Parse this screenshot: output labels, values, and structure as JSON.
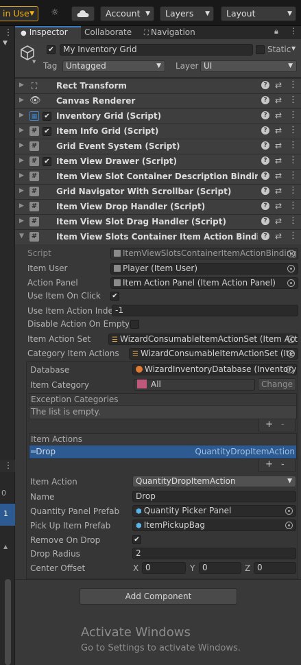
{
  "toolbar": {
    "in_use": "in Use",
    "account": "Account",
    "layers": "Layers",
    "layout": "Layout"
  },
  "tabs": [
    "Inspector",
    "Collaborate",
    "Navigation"
  ],
  "header": {
    "object_name": "My Inventory Grid",
    "static_label": "Static",
    "tag_label": "Tag",
    "tag_value": "Untagged",
    "layer_label": "Layer",
    "layer_value": "UI"
  },
  "components": [
    {
      "name": "Rect Transform",
      "icon": "rect-transform-icon",
      "checkbox": false
    },
    {
      "name": "Canvas Renderer",
      "icon": "eye-icon",
      "checkbox": false
    },
    {
      "name": "Inventory Grid (Script)",
      "icon": "grid-icon",
      "checkbox": true
    },
    {
      "name": "Item Info Grid (Script)",
      "icon": "script-icon",
      "checkbox": true
    },
    {
      "name": "Grid Event System (Script)",
      "icon": "script-icon",
      "checkbox": false
    },
    {
      "name": "Item View Drawer (Script)",
      "icon": "script-icon",
      "checkbox": true
    },
    {
      "name": "Item View Slot Container Description Binding (Scri",
      "icon": "script-icon",
      "checkbox": false
    },
    {
      "name": "Grid Navigator With Scrollbar (Script)",
      "icon": "script-icon",
      "checkbox": false
    },
    {
      "name": "Item View Drop Handler (Script)",
      "icon": "script-icon",
      "checkbox": false
    },
    {
      "name": "Item View Slot Drag Handler (Script)",
      "icon": "script-icon",
      "checkbox": false
    },
    {
      "name": "Item View Slots Container Item Action Binding (Sc",
      "icon": "script-icon",
      "checkbox": false
    }
  ],
  "props": {
    "script_label": "Script",
    "script_value": "ItemViewSlotsContainerItemActionBinding",
    "item_user_label": "Item User",
    "item_user_value": "Player (Item User)",
    "action_panel_label": "Action Panel",
    "action_panel_value": "Item Action Panel (Item Action Panel)",
    "use_item_label": "Use Item On Click",
    "use_item_checked": true,
    "use_index_label": "Use Item Action Index",
    "use_index_value": "-1",
    "disable_label": "Disable Action On Empty S",
    "disable_checked": false,
    "action_set_label": "Item Action Set",
    "action_set_value": "WizardConsumableItemActionSet (Item Act",
    "category_label": "Category Item Actions",
    "category_value": "WizardConsumableItemActionSet (Ite"
  },
  "sub": {
    "database_label": "Database",
    "database_value": "WizardInventoryDatabase (Inventory",
    "item_category_label": "Item Category",
    "item_category_value": "All",
    "change_button": "Change",
    "exception_header": "Exception Categories",
    "exception_empty": "The list is empty.",
    "plus": "+",
    "minus": "-",
    "item_actions_header": "Item Actions",
    "row_left": "Drop",
    "row_right": "QuantityDropItemAction",
    "item_action_label": "Item Action",
    "item_action_value": "QuantityDropItemAction",
    "name_label": "Name",
    "name_value": "Drop",
    "quantity_label": "Quantity Panel Prefab",
    "quantity_value": "Quantity Picker Panel",
    "pickup_label": "Pick Up Item Prefab",
    "pickup_value": "ItemPickupBag",
    "remove_label": "Remove On Drop",
    "remove_checked": true,
    "radius_label": "Drop Radius",
    "radius_value": "2",
    "offset_label": "Center Offset",
    "x_label": "X",
    "x_value": "0",
    "y_label": "Y",
    "y_value": "0",
    "z_label": "Z",
    "z_value": "0"
  },
  "footer": {
    "add_component": "Add Component",
    "activate_title": "Activate Windows",
    "activate_sub": "Go to Settings to activate Windows."
  },
  "left_strip": {
    "value_0": "0",
    "value_1": "1"
  },
  "colors": {
    "accent": "#3a79bb",
    "selection": "#2d5a91",
    "in_use": "#f3b317"
  }
}
